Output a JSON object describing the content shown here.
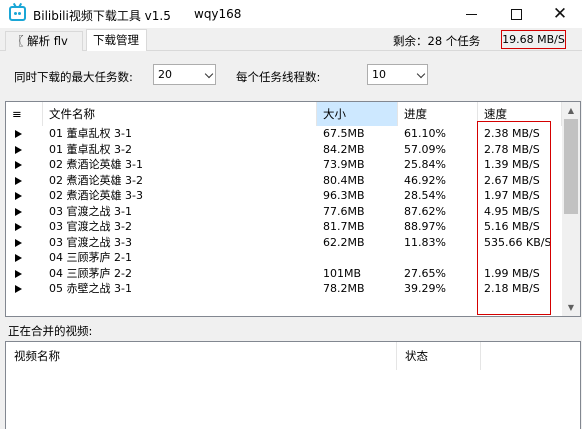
{
  "window": {
    "title": "Bilibili视频下载工具 v1.5",
    "user": "wqy168",
    "controls": {
      "close": "✕"
    }
  },
  "tabs": [
    {
      "label": "〖 解析 flv 〗"
    },
    {
      "label": "下载管理",
      "selected": true
    }
  ],
  "status": {
    "remaining": "剩余：28 个任务",
    "total_speed": "19.68 MB/S"
  },
  "settings": {
    "max_tasks_label": "同时下载的最大任务数:",
    "max_tasks_value": "20",
    "threads_label": "每个任务线程数:",
    "threads_value": "10"
  },
  "download_list": {
    "columns": [
      "≡",
      "文件名称",
      "大小",
      "进度",
      "速度"
    ],
    "rows": [
      {
        "name": "01 董卓乱权 3-1",
        "size": "67.5MB",
        "progress": "61.10%",
        "speed": "2.38 MB/S"
      },
      {
        "name": "01 董卓乱权 3-2",
        "size": "84.2MB",
        "progress": "57.09%",
        "speed": "2.78 MB/S"
      },
      {
        "name": "02 煮酒论英雄 3-1",
        "size": "73.9MB",
        "progress": "25.84%",
        "speed": "1.39 MB/S"
      },
      {
        "name": "02 煮酒论英雄 3-2",
        "size": "80.4MB",
        "progress": "46.92%",
        "speed": "2.67 MB/S"
      },
      {
        "name": "02 煮酒论英雄 3-3",
        "size": "96.3MB",
        "progress": "28.54%",
        "speed": "1.97 MB/S"
      },
      {
        "name": "03 官渡之战 3-1",
        "size": "77.6MB",
        "progress": "87.62%",
        "speed": "4.95 MB/S"
      },
      {
        "name": "03 官渡之战 3-2",
        "size": "81.7MB",
        "progress": "88.97%",
        "speed": "5.16 MB/S"
      },
      {
        "name": "03 官渡之战 3-3",
        "size": "62.2MB",
        "progress": "11.83%",
        "speed": "535.66 KB/S"
      },
      {
        "name": "04 三顾茅庐 2-1",
        "size": "",
        "progress": "",
        "speed": ""
      },
      {
        "name": "04 三顾茅庐 2-2",
        "size": "101MB",
        "progress": "27.65%",
        "speed": "1.99 MB/S"
      },
      {
        "name": "05 赤壁之战 3-1",
        "size": "78.2MB",
        "progress": "39.29%",
        "speed": "2.18 MB/S"
      }
    ]
  },
  "merge": {
    "label": "正在合并的视频:",
    "columns": [
      "视频名称",
      "状态"
    ]
  }
}
